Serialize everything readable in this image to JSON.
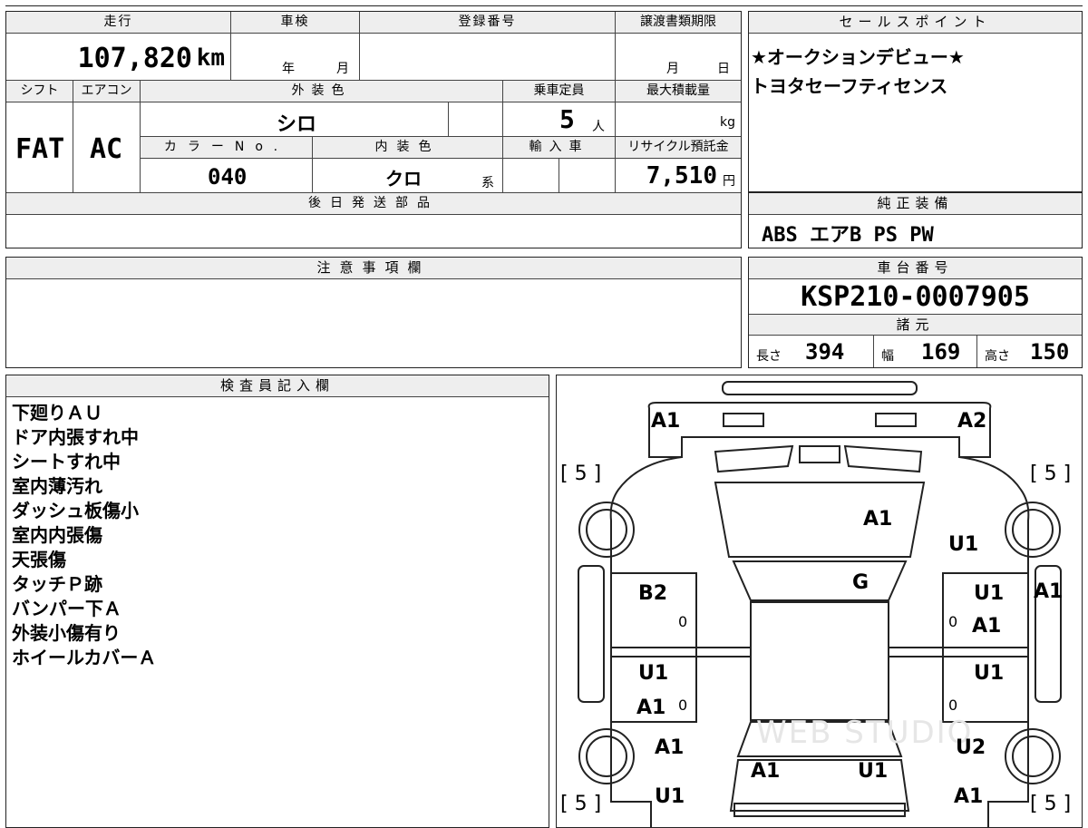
{
  "mileage": {
    "label": "走行",
    "value": "107,820",
    "unit": "km"
  },
  "inspection": {
    "label": "車検",
    "year_unit": "年",
    "month_unit": "月"
  },
  "registration": {
    "label": "登録番号",
    "value": ""
  },
  "transfer_deadline": {
    "label": "譲渡書類期限",
    "month_unit": "月",
    "day_unit": "日"
  },
  "shift": {
    "label": "シフト",
    "value": "FAT"
  },
  "aircon": {
    "label": "エアコン",
    "value": "AC"
  },
  "exterior_color": {
    "label": "外装色",
    "value": "シロ"
  },
  "capacity": {
    "label": "乗車定員",
    "value": "5",
    "unit": "人"
  },
  "max_load": {
    "label": "最大積載量",
    "value": "",
    "unit": "kg"
  },
  "color_no": {
    "label": "カラーNo.",
    "value": "040"
  },
  "interior_color": {
    "label": "内装色",
    "value": "クロ",
    "suffix": "系"
  },
  "import": {
    "label": "輸入車"
  },
  "recycle": {
    "label": "リサイクル預託金",
    "value": "7,510",
    "unit": "円"
  },
  "later_parts": {
    "label": "後日発送部品",
    "value": ""
  },
  "sales_points": {
    "label": "セールスポイント",
    "lines": [
      "★オークションデビュー★",
      "トヨタセーフティセンス"
    ]
  },
  "equipment": {
    "label": "純正装備",
    "value": "ABS エアB PS PW"
  },
  "notes": {
    "label": "注意事項欄",
    "value": ""
  },
  "chassis": {
    "label": "車台番号",
    "value": "KSP210-0007905"
  },
  "specs": {
    "label": "諸元",
    "length_label": "長さ",
    "length": "394",
    "width_label": "幅",
    "width": "169",
    "height_label": "高さ",
    "height": "150"
  },
  "inspector": {
    "label": "検査員記入欄",
    "lines": [
      "下廻りＡＵ",
      "ドア内張すれ中",
      "シートすれ中",
      "室内薄汚れ",
      "ダッシュ板傷小",
      "室内内張傷",
      "天張傷",
      "タッチＰ跡",
      "バンパー下Ａ",
      "外装小傷有り",
      "ホイールカバーＡ"
    ]
  },
  "diagram": {
    "watermark": "WEB STUDIO",
    "tire_tl": "[ 5 ]",
    "tire_tr": "[ 5 ]",
    "tire_bl": "[ 5 ]",
    "tire_br": "[ 5 ]",
    "front_left": "A1",
    "front_right": "A2",
    "hood": "A1",
    "fender_right_upper": "U1",
    "windshield": "G",
    "left_front_door": "B2",
    "left_front_door_num": "0",
    "right_front_door_a": "U1",
    "right_front_door_b": "A1",
    "right_front_door_num": "0",
    "right_outer": "A1",
    "left_rear_door_a": "U1",
    "left_rear_door_b": "A1",
    "left_rear_door_num": "0",
    "right_rear_door": "U1",
    "right_rear_door_num": "0",
    "left_quarter": "A1",
    "right_quarter": "U2",
    "trunk_left": "A1",
    "trunk_right": "U1",
    "rear_left": "U1",
    "rear_right": "A1"
  }
}
